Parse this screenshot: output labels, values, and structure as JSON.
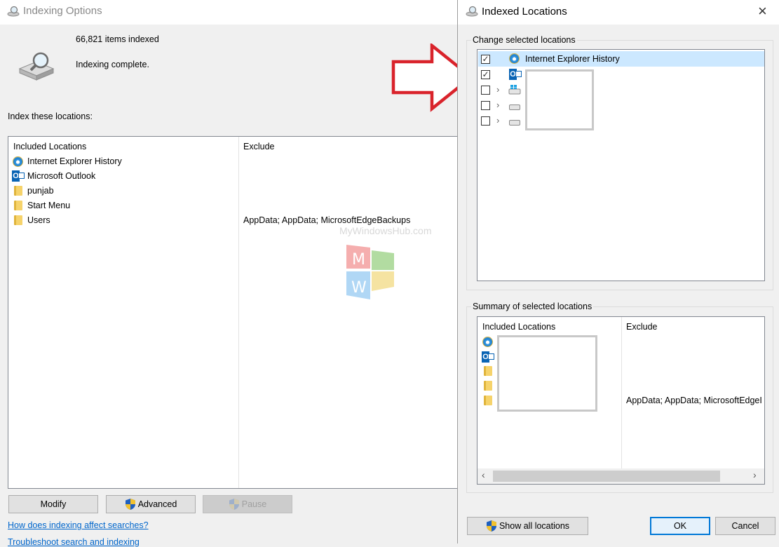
{
  "indexing_options": {
    "title": "Indexing Options",
    "items_count": "66,821 items indexed",
    "status": "Indexing complete.",
    "index_these_locations_label": "Index these locations:",
    "table": {
      "headers": {
        "included": "Included Locations",
        "exclude": "Exclude"
      },
      "rows": [
        {
          "name": "Internet Explorer History",
          "icon": "ie-icon",
          "exclude": ""
        },
        {
          "name": "Microsoft Outlook",
          "icon": "outlook-icon",
          "exclude": ""
        },
        {
          "name": "punjab",
          "icon": "folder-icon",
          "exclude": ""
        },
        {
          "name": "Start Menu",
          "icon": "folder-icon",
          "exclude": ""
        },
        {
          "name": "Users",
          "icon": "folder-icon",
          "exclude": "AppData; AppData; MicrosoftEdgeBackups"
        }
      ]
    },
    "buttons": {
      "modify": "Modify",
      "advanced": "Advanced",
      "pause": "Pause"
    },
    "links": {
      "how_does": "How does indexing affect searches?",
      "troubleshoot": "Troubleshoot search and indexing"
    },
    "watermark": "MyWindowsHub.com"
  },
  "indexed_locations": {
    "title": "Indexed Locations",
    "change_label": "Change selected locations",
    "tree": [
      {
        "label": "Internet Explorer History",
        "checked": true,
        "icon": "ie-icon",
        "expandable": false
      },
      {
        "label": "",
        "checked": true,
        "icon": "outlook-icon",
        "expandable": false
      },
      {
        "label": "",
        "checked": false,
        "icon": "windows-drive-icon",
        "expandable": true
      },
      {
        "label": "",
        "checked": false,
        "icon": "drive-icon",
        "expandable": true
      },
      {
        "label": "",
        "checked": false,
        "icon": "drive-icon",
        "expandable": true
      }
    ],
    "summary_label": "Summary of selected locations",
    "summary_headers": {
      "included": "Included Locations",
      "exclude": "Exclude"
    },
    "summary_exclude_users": "AppData; AppData; MicrosoftEdgeI",
    "buttons": {
      "show_all": "Show all locations",
      "ok": "OK",
      "cancel": "Cancel"
    }
  },
  "colors": {
    "arrow_red": "#d9232b",
    "accent": "#0078d7",
    "link": "#0066cc"
  }
}
